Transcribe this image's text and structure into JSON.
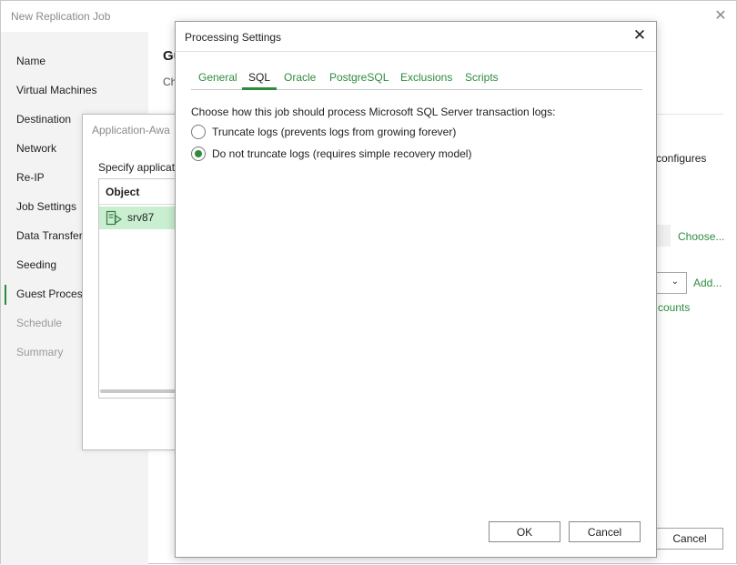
{
  "main_window": {
    "title": "New Replication Job",
    "close_glyph": "✕",
    "nav": {
      "items": [
        {
          "label": "Name"
        },
        {
          "label": "Virtual Machines"
        },
        {
          "label": "Destination"
        },
        {
          "label": "Network"
        },
        {
          "label": "Re-IP"
        },
        {
          "label": "Job Settings"
        },
        {
          "label": "Data Transfer"
        },
        {
          "label": "Seeding"
        },
        {
          "label": "Guest Process"
        },
        {
          "label": "Schedule"
        },
        {
          "label": "Summary"
        }
      ],
      "active_item": "Guest Process"
    },
    "content": {
      "heading": "Gu",
      "subtext": "Ch",
      "configures_text": "configures",
      "choose_link": "Choose...",
      "add_link": "Add...",
      "accounts_link": "counts",
      "cancel_label": "Cancel"
    }
  },
  "app_aware_dialog": {
    "title": "Application-Awa",
    "prompt": "Specify applicati",
    "table": {
      "column_header": "Object",
      "rows": [
        {
          "name": "srv87",
          "icon": "vm-server-icon"
        }
      ]
    }
  },
  "processing_settings": {
    "title": "Processing Settings",
    "close_glyph": "✕",
    "tabs": [
      {
        "label": "General"
      },
      {
        "label": "SQL"
      },
      {
        "label": "Oracle"
      },
      {
        "label": "PostgreSQL"
      },
      {
        "label": "Exclusions"
      },
      {
        "label": "Scripts"
      }
    ],
    "active_tab": "SQL",
    "instruction": "Choose how this job should process Microsoft SQL Server transaction logs:",
    "options": [
      {
        "label": "Truncate logs (prevents logs from growing forever)",
        "checked": false
      },
      {
        "label": "Do not truncate logs (requires simple recovery model)",
        "checked": true
      }
    ],
    "ok_label": "OK",
    "cancel_label": "Cancel"
  },
  "colors": {
    "accent_green": "#2e8b3e",
    "selection_green": "#c9efd0",
    "nav_background": "#f3f3f3"
  }
}
